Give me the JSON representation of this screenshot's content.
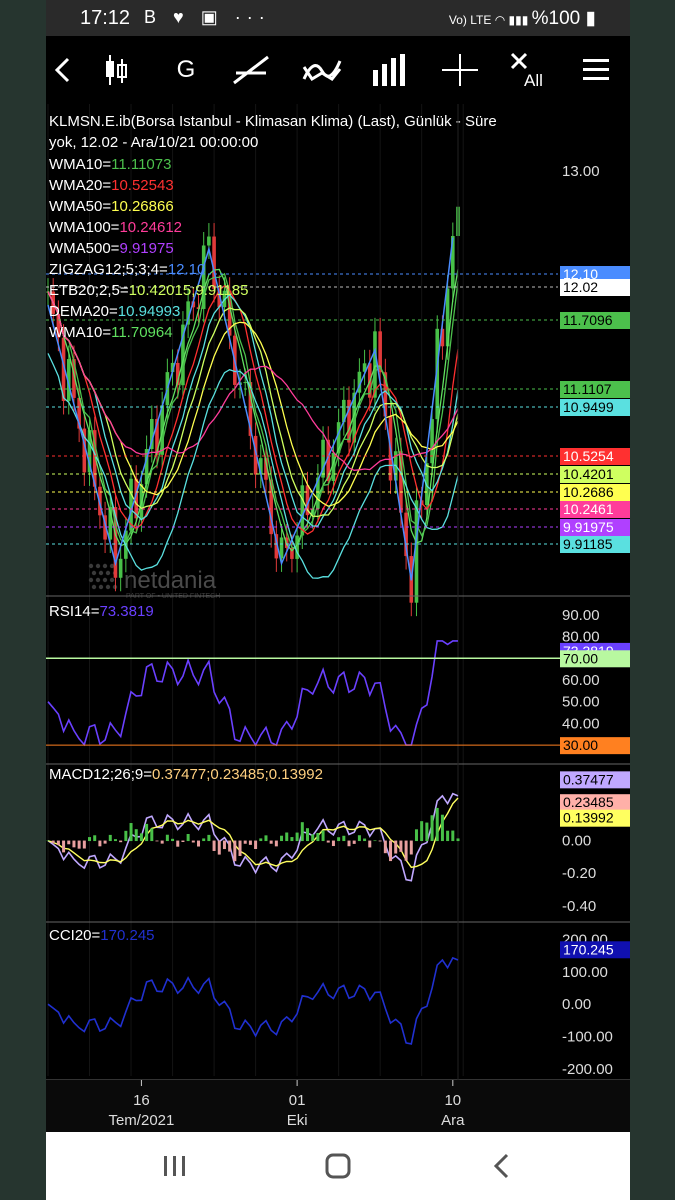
{
  "status": {
    "time": "17:12",
    "app_icons": "B ♥ ▣ ···",
    "right": "%100"
  },
  "toolbar": {
    "g_label": "G",
    "all_label": "All"
  },
  "chart_data": {
    "type": "line",
    "header": {
      "line1": "KLMSN.E.ib(Borsa Istanbul - Klimasan Klima) (Last),  Günlük - Süre",
      "line2": "yok, 12.02 - Ara/10/21 00:00:00"
    },
    "indicators": [
      {
        "label": "WMA10=",
        "value": "11.11073",
        "color": "#4cc04c"
      },
      {
        "label": "WMA20=",
        "value": "10.52543",
        "color": "#ff3030"
      },
      {
        "label": "WMA50=",
        "value": "10.26866",
        "color": "#ffff50"
      },
      {
        "label": "WMA100=",
        "value": "10.24612",
        "color": "#ff3c9a"
      },
      {
        "label": "WMA500=",
        "value": "9.91975",
        "color": "#b040ff"
      },
      {
        "label": "ZIGZAG12;5;3;4=",
        "value": "12.10",
        "color": "#4a8cff"
      },
      {
        "label": "ETB20;2,5=",
        "value": "10.42015;9.91185",
        "color": "#cfff60"
      },
      {
        "label": "DEMA20=",
        "value": "10.94993",
        "color": "#5ae0e0"
      },
      {
        "label": "WMA10=",
        "value": "11.70964",
        "color": "#60e060"
      }
    ],
    "price_axis": {
      "ticks": [
        "13.00"
      ]
    },
    "price_labels": [
      {
        "text": "12.10",
        "bg": "#4a8cff",
        "fg": "#fff",
        "line": "#4a8cff"
      },
      {
        "text": "12.02",
        "bg": "#ffffff",
        "fg": "#000",
        "line": "#bbbbbb"
      },
      {
        "text": "11.7096",
        "bg": "#4cc04c",
        "fg": "#000",
        "line": "#4cc04c"
      },
      {
        "text": "11.1107",
        "bg": "#4cc04c",
        "fg": "#000",
        "line": "#4cc04c"
      },
      {
        "text": "10.9499",
        "bg": "#5ae0e0",
        "fg": "#000",
        "line": "#5ae0e0"
      },
      {
        "text": "10.5254",
        "bg": "#ff3030",
        "fg": "#fff",
        "line": "#ff3030"
      },
      {
        "text": "10.4201",
        "bg": "#cfff60",
        "fg": "#000",
        "line": "#cfff60"
      },
      {
        "text": "10.2686",
        "bg": "#ffff50",
        "fg": "#000",
        "line": "#ffff50"
      },
      {
        "text": "10.2461",
        "bg": "#ff3c9a",
        "fg": "#fff",
        "line": "#ff3c9a"
      },
      {
        "text": "9.91975",
        "bg": "#b040ff",
        "fg": "#fff",
        "line": "#b040ff"
      },
      {
        "text": "9.91185",
        "bg": "#5ae0e0",
        "fg": "#000",
        "line": "#5ae0e0"
      }
    ],
    "zigzag": [
      [
        0,
        11.5
      ],
      [
        13,
        9.2
      ],
      [
        31,
        12.0
      ],
      [
        45,
        9.2
      ],
      [
        63,
        11.1
      ],
      [
        70,
        9.05
      ],
      [
        78,
        12.1
      ]
    ],
    "rsi": {
      "label": "RSI14=",
      "value": "73.3819",
      "color": "#6a40ff",
      "ticks": [
        "90.00",
        "80.00",
        "60.00",
        "50.00",
        "40.00"
      ],
      "ylim": [
        25,
        95
      ],
      "levels": [
        {
          "text": "73.3819",
          "bg": "#6a40ff",
          "fg": "#fff",
          "value": 73.4
        },
        {
          "text": "70.00",
          "bg": "#b8f8a0",
          "fg": "#000",
          "value": 70
        },
        {
          "text": "30.00",
          "bg": "#ff8020",
          "fg": "#000",
          "value": 30
        }
      ]
    },
    "macd": {
      "label": "MACD12;26;9=",
      "value": "0.37477;0.23485;0.13992",
      "ticks": [
        "0.00",
        "-0.20",
        "-0.40"
      ],
      "ylim": [
        -0.45,
        0.42
      ],
      "levels": [
        {
          "text": "0.37477",
          "bg": "#c0a8ff",
          "fg": "#000",
          "value": 0.375
        },
        {
          "text": "0.23485",
          "bg": "#ffb0a8",
          "fg": "#000",
          "value": 0.235
        },
        {
          "text": "0.13992",
          "bg": "#ffff60",
          "fg": "#000",
          "value": 0.14
        }
      ]
    },
    "cci": {
      "label": "CCI20=",
      "value": "170.245",
      "color": "#2030d0",
      "ticks": [
        "200.00",
        "100.00",
        "0.00",
        "-100.00",
        "-200.00"
      ],
      "ylim": [
        -210,
        230
      ],
      "levels": [
        {
          "text": "170.245",
          "bg": "#1010b0",
          "fg": "#fff",
          "value": 170.245
        }
      ]
    },
    "x_axis": [
      {
        "text": "16",
        "sub": "Tem/2021",
        "i": 18
      },
      {
        "text": "01",
        "sub": "Eki",
        "i": 48
      },
      {
        "text": "10",
        "sub": "Ara",
        "i": 78
      }
    ],
    "watermark": "netdania",
    "watermark_sub": "PART OF ▪ UNITED FINTECH"
  }
}
